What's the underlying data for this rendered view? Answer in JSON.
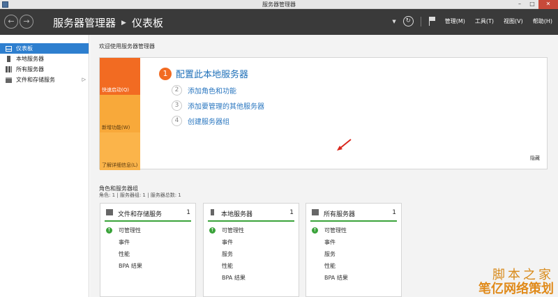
{
  "window": {
    "title": "服务器管理器",
    "minimize": "–",
    "maximize": "□",
    "close": "✕"
  },
  "header": {
    "breadcrumb": [
      "服务器管理器",
      "仪表板"
    ],
    "menus": [
      "管理(M)",
      "工具(T)",
      "视图(V)",
      "帮助(H)"
    ]
  },
  "sidebar": {
    "items": [
      {
        "label": "仪表板",
        "icon": "dashboard-icon",
        "active": true
      },
      {
        "label": "本地服务器",
        "icon": "server-icon"
      },
      {
        "label": "所有服务器",
        "icon": "servers-icon"
      },
      {
        "label": "文件和存储服务",
        "icon": "storage-icon",
        "expand": "▷"
      }
    ]
  },
  "welcome": {
    "title": "欢迎使用服务器管理器",
    "tiles": [
      "快速启动(Q)",
      "新增功能(W)",
      "了解详细信息(L)"
    ],
    "main_step": {
      "number": "1",
      "label": "配置此本地服务器"
    },
    "steps": [
      {
        "number": "2",
        "label": "添加角色和功能"
      },
      {
        "number": "3",
        "label": "添加要管理的其他服务器"
      },
      {
        "number": "4",
        "label": "创建服务器组"
      }
    ],
    "hide": "隐藏"
  },
  "roles": {
    "title": "角色和服务器组",
    "subtitle": "角色: 1 | 服务器组: 1 | 服务器总数: 1",
    "cards": [
      {
        "title": "文件和存储服务",
        "count": "1",
        "rows": [
          "可管理性",
          "事件",
          "性能",
          "BPA 结果"
        ]
      },
      {
        "title": "本地服务器",
        "count": "1",
        "rows": [
          "可管理性",
          "事件",
          "服务",
          "性能",
          "BPA 结果"
        ]
      },
      {
        "title": "所有服务器",
        "count": "1",
        "rows": [
          "可管理性",
          "事件",
          "服务",
          "性能",
          "BPA 结果"
        ]
      }
    ]
  },
  "watermark": {
    "line1": "脚本之家",
    "line2": "笔亿网络策划"
  },
  "colors": {
    "accent": "#2e7fcf",
    "orange": "#f26b22",
    "green": "#3aa33a",
    "header": "#3a3a3a"
  }
}
